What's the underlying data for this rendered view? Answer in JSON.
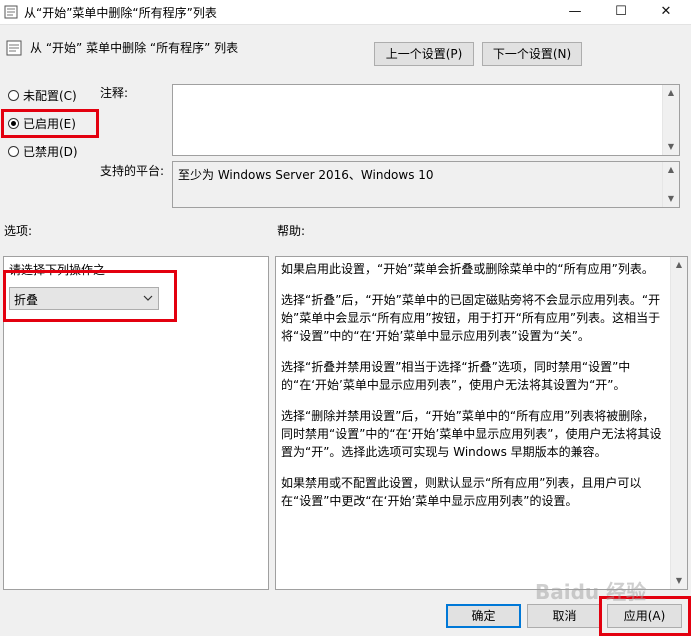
{
  "window": {
    "title": "从“开始”菜单中删除“所有程序”列表",
    "controls": {
      "minimize": "—",
      "maximize": "☐",
      "close": "✕"
    }
  },
  "header": {
    "policy_name": "从 “开始” 菜单中删除 “所有程序” 列表",
    "prev_button": "上一个设置(P)",
    "next_button": "下一个设置(N)"
  },
  "state": {
    "options": [
      {
        "label": "未配置(C)",
        "selected": false
      },
      {
        "label": "已启用(E)",
        "selected": true
      },
      {
        "label": "已禁用(D)",
        "selected": false
      }
    ]
  },
  "comment": {
    "label": "注释:",
    "value": ""
  },
  "platform": {
    "label": "支持的平台:",
    "value": "至少为 Windows Server 2016、Windows 10"
  },
  "options_section": {
    "label": "选项:",
    "dropdown_label": "请选择下列操作之",
    "dropdown_value": "折叠"
  },
  "help_section": {
    "label": "帮助:",
    "paragraphs": [
      "如果启用此设置，“开始”菜单会折叠或删除菜单中的“所有应用”列表。",
      "选择“折叠”后，“开始”菜单中的已固定磁贴旁将不会显示应用列表。“开始”菜单中会显示“所有应用”按钮，用于打开“所有应用”列表。这相当于将“设置”中的“在‘开始’菜单中显示应用列表”设置为“关”。",
      "选择“折叠并禁用设置”相当于选择“折叠”选项，同时禁用“设置”中的“在‘开始’菜单中显示应用列表”，使用户无法将其设置为“开”。",
      "选择“删除并禁用设置”后，“开始”菜单中的“所有应用”列表将被删除，同时禁用“设置”中的“在‘开始’菜单中显示应用列表”，使用户无法将其设置为“开”。选择此选项可实现与 Windows 早期版本的兼容。",
      "如果禁用或不配置此设置，则默认显示“所有应用”列表，且用户可以在“设置”中更改“在‘开始’菜单中显示应用列表”的设置。"
    ]
  },
  "footer": {
    "ok": "确定",
    "cancel": "取消",
    "apply": "应用(A)"
  },
  "watermark": "Baidu 经验",
  "colors": {
    "highlight_red": "#e3000f",
    "ok_border": "#0078d7",
    "dialog_bg": "#f0f0f0"
  }
}
